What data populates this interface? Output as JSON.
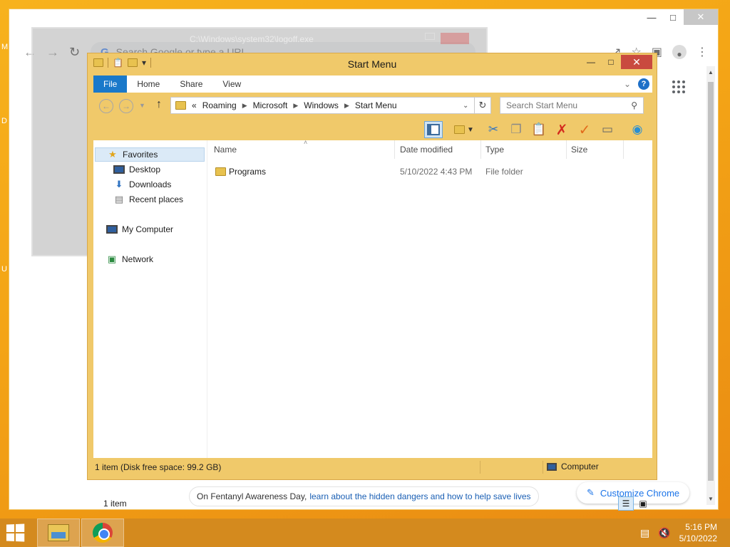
{
  "desktop": {
    "labels": [
      "M",
      "D",
      "U"
    ]
  },
  "chrome": {
    "omnibox_placeholder": "Search Google or type a URL",
    "omnibox_icon": "google-g-icon",
    "banner": {
      "prefix": "On Fentanyl Awareness Day,",
      "link": "learn about the hidden dangers and how to help save lives"
    },
    "customize_label": "Customize Chrome"
  },
  "ghost_dialog": {
    "title": "C:\\Windows\\system32\\logoff.exe"
  },
  "explorer": {
    "title": "Start Menu",
    "ribbon_tabs": [
      "File",
      "Home",
      "Share",
      "View"
    ],
    "address": {
      "prefix": "«",
      "crumbs": [
        "Roaming",
        "Microsoft",
        "Windows",
        "Start Menu"
      ]
    },
    "search_placeholder": "Search Start Menu",
    "nav": {
      "favorites": "Favorites",
      "desktop": "Desktop",
      "downloads": "Downloads",
      "recent": "Recent places",
      "computer": "My Computer",
      "network": "Network"
    },
    "columns": {
      "name": "Name",
      "date": "Date modified",
      "type": "Type",
      "size": "Size"
    },
    "files": [
      {
        "name": "Programs",
        "date": "5/10/2022 4:43 PM",
        "type": "File folder",
        "size": ""
      }
    ],
    "item_count": "1 item",
    "status_left": "1 item (Disk free space: 99.2 GB)",
    "status_right": "Computer"
  },
  "taskbar": {
    "time": "5:16 PM",
    "date": "5/10/2022"
  },
  "colors": {
    "accent_file_tab": "#1979ca",
    "window_frame": "#f0c96a",
    "close_button": "#c94a3f",
    "taskbar": "#d48a1e"
  }
}
